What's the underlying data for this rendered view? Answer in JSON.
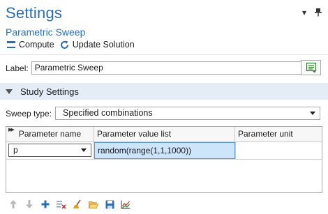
{
  "window": {
    "title": "Settings",
    "subtitle": "Parametric Sweep"
  },
  "toolbar": {
    "compute_label": "Compute",
    "update_label": "Update Solution"
  },
  "label_field": {
    "label": "Label:",
    "value": "Parametric Sweep"
  },
  "section": {
    "title": "Study Settings"
  },
  "sweep_type": {
    "label": "Sweep type:",
    "selected": "Specified combinations"
  },
  "table": {
    "columns": [
      "Parameter name",
      "Parameter value list",
      "Parameter unit"
    ],
    "rows": [
      {
        "name": "p",
        "values": "random(range(1,1,1000))",
        "unit": ""
      }
    ]
  },
  "bottom_toolbar": {
    "icons": [
      "move-up-icon",
      "move-down-icon",
      "add-icon",
      "delete-icon",
      "clear-table-icon",
      "load-from-file-icon",
      "save-to-file-icon",
      "plot-icon"
    ]
  },
  "colors": {
    "accent": "#2a6db4",
    "section_bg": "#e4ecf5",
    "selected_cell": "#cde5fb"
  }
}
